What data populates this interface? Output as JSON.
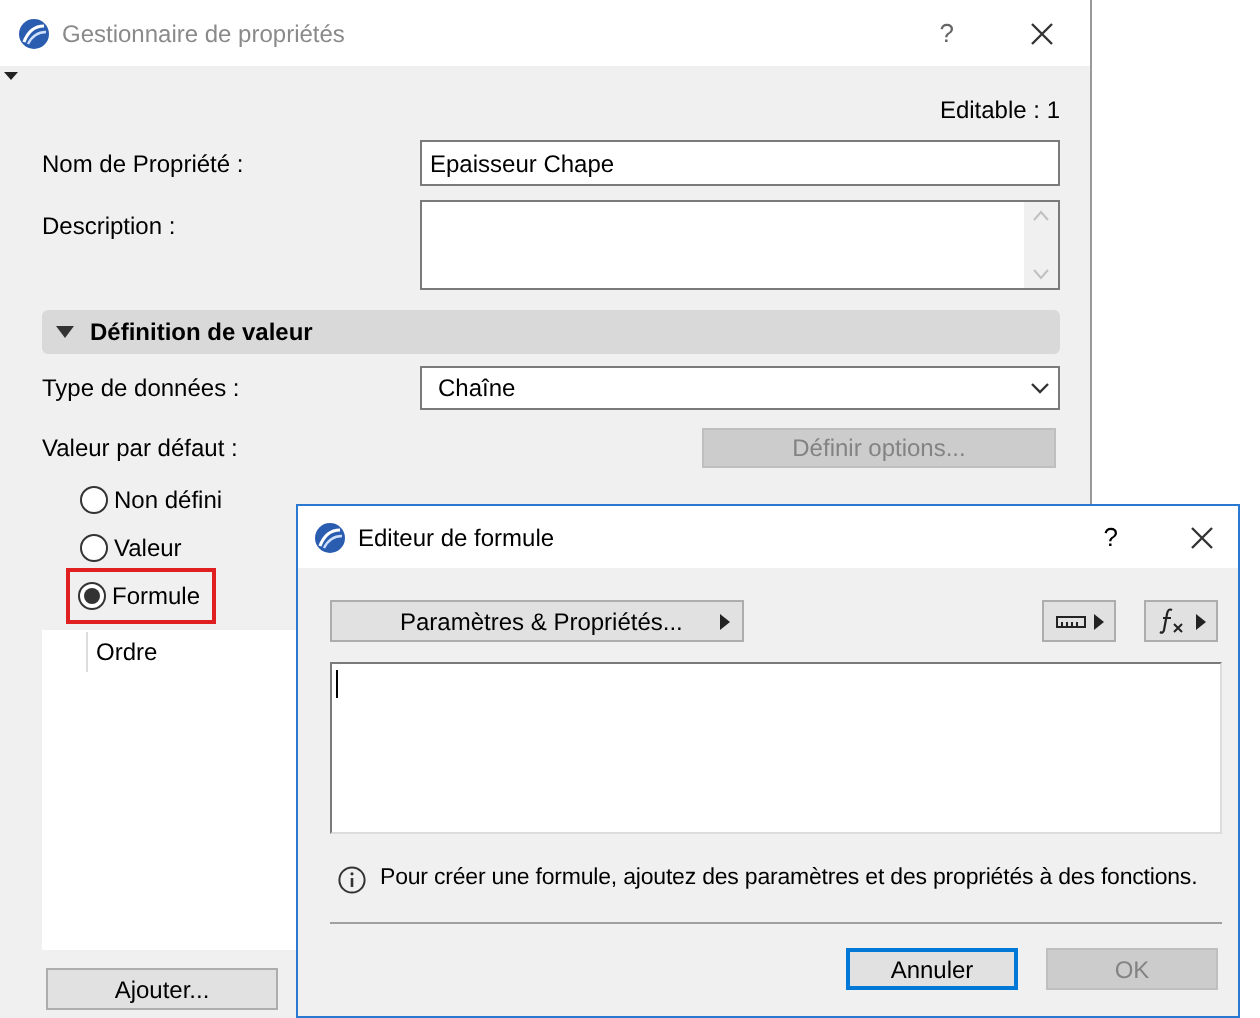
{
  "back_window": {
    "title": "Gestionnaire de propriétés",
    "help": "?",
    "editable": "Editable : 1",
    "fields": [
      {
        "label": "Nom de Propriété :",
        "kind": "text",
        "value": "Epaisseur Chape"
      },
      {
        "label": "Description :",
        "kind": "textarea"
      }
    ],
    "section": {
      "title": "Définition de valeur",
      "expanded": true
    },
    "data_type": {
      "label": "Type de données :",
      "value": "Chaîne"
    },
    "default_value": {
      "label": "Valeur par défaut :",
      "button": "Définir options...",
      "button_disabled": true
    },
    "options": [
      {
        "label": "Non défini",
        "selected": false,
        "highlighted": false
      },
      {
        "label": "Valeur",
        "selected": false,
        "highlighted": false
      },
      {
        "label": "Formule",
        "selected": true,
        "highlighted": true
      }
    ],
    "list": {
      "items": [
        "Ordre"
      ]
    },
    "add_button": "Ajouter..."
  },
  "formula_editor": {
    "title": "Editeur de formule",
    "help": "?",
    "params_button": "Paramètres & Propriétés...",
    "info": "Pour créer une formule, ajoutez des paramètres et des propriétés à des fonctions.",
    "buttons": [
      {
        "label": "Annuler",
        "default": true,
        "disabled": false
      },
      {
        "label": "OK",
        "default": false,
        "disabled": true
      }
    ]
  }
}
